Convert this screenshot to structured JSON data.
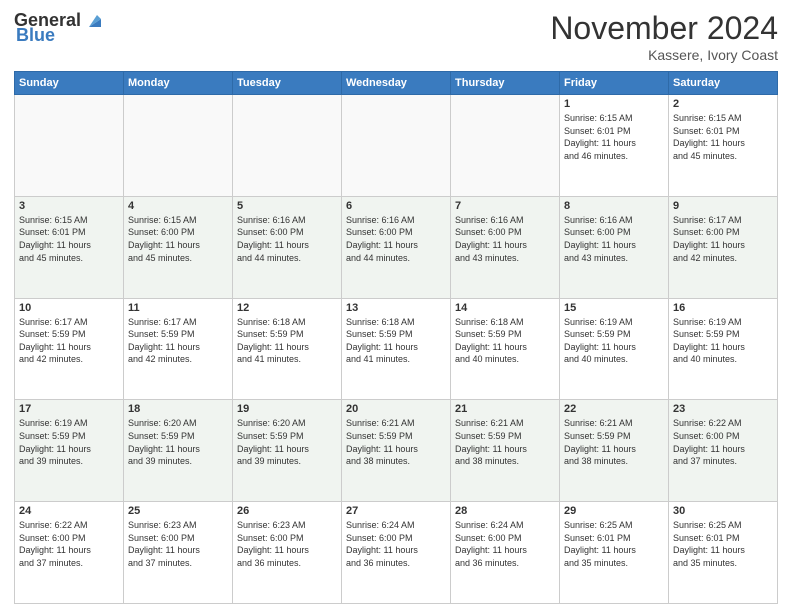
{
  "logo": {
    "general": "General",
    "blue": "Blue"
  },
  "header": {
    "month": "November 2024",
    "location": "Kassere, Ivory Coast"
  },
  "weekdays": [
    "Sunday",
    "Monday",
    "Tuesday",
    "Wednesday",
    "Thursday",
    "Friday",
    "Saturday"
  ],
  "weeks": [
    [
      {
        "day": "",
        "info": ""
      },
      {
        "day": "",
        "info": ""
      },
      {
        "day": "",
        "info": ""
      },
      {
        "day": "",
        "info": ""
      },
      {
        "day": "",
        "info": ""
      },
      {
        "day": "1",
        "info": "Sunrise: 6:15 AM\nSunset: 6:01 PM\nDaylight: 11 hours\nand 46 minutes."
      },
      {
        "day": "2",
        "info": "Sunrise: 6:15 AM\nSunset: 6:01 PM\nDaylight: 11 hours\nand 45 minutes."
      }
    ],
    [
      {
        "day": "3",
        "info": "Sunrise: 6:15 AM\nSunset: 6:01 PM\nDaylight: 11 hours\nand 45 minutes."
      },
      {
        "day": "4",
        "info": "Sunrise: 6:15 AM\nSunset: 6:00 PM\nDaylight: 11 hours\nand 45 minutes."
      },
      {
        "day": "5",
        "info": "Sunrise: 6:16 AM\nSunset: 6:00 PM\nDaylight: 11 hours\nand 44 minutes."
      },
      {
        "day": "6",
        "info": "Sunrise: 6:16 AM\nSunset: 6:00 PM\nDaylight: 11 hours\nand 44 minutes."
      },
      {
        "day": "7",
        "info": "Sunrise: 6:16 AM\nSunset: 6:00 PM\nDaylight: 11 hours\nand 43 minutes."
      },
      {
        "day": "8",
        "info": "Sunrise: 6:16 AM\nSunset: 6:00 PM\nDaylight: 11 hours\nand 43 minutes."
      },
      {
        "day": "9",
        "info": "Sunrise: 6:17 AM\nSunset: 6:00 PM\nDaylight: 11 hours\nand 42 minutes."
      }
    ],
    [
      {
        "day": "10",
        "info": "Sunrise: 6:17 AM\nSunset: 5:59 PM\nDaylight: 11 hours\nand 42 minutes."
      },
      {
        "day": "11",
        "info": "Sunrise: 6:17 AM\nSunset: 5:59 PM\nDaylight: 11 hours\nand 42 minutes."
      },
      {
        "day": "12",
        "info": "Sunrise: 6:18 AM\nSunset: 5:59 PM\nDaylight: 11 hours\nand 41 minutes."
      },
      {
        "day": "13",
        "info": "Sunrise: 6:18 AM\nSunset: 5:59 PM\nDaylight: 11 hours\nand 41 minutes."
      },
      {
        "day": "14",
        "info": "Sunrise: 6:18 AM\nSunset: 5:59 PM\nDaylight: 11 hours\nand 40 minutes."
      },
      {
        "day": "15",
        "info": "Sunrise: 6:19 AM\nSunset: 5:59 PM\nDaylight: 11 hours\nand 40 minutes."
      },
      {
        "day": "16",
        "info": "Sunrise: 6:19 AM\nSunset: 5:59 PM\nDaylight: 11 hours\nand 40 minutes."
      }
    ],
    [
      {
        "day": "17",
        "info": "Sunrise: 6:19 AM\nSunset: 5:59 PM\nDaylight: 11 hours\nand 39 minutes."
      },
      {
        "day": "18",
        "info": "Sunrise: 6:20 AM\nSunset: 5:59 PM\nDaylight: 11 hours\nand 39 minutes."
      },
      {
        "day": "19",
        "info": "Sunrise: 6:20 AM\nSunset: 5:59 PM\nDaylight: 11 hours\nand 39 minutes."
      },
      {
        "day": "20",
        "info": "Sunrise: 6:21 AM\nSunset: 5:59 PM\nDaylight: 11 hours\nand 38 minutes."
      },
      {
        "day": "21",
        "info": "Sunrise: 6:21 AM\nSunset: 5:59 PM\nDaylight: 11 hours\nand 38 minutes."
      },
      {
        "day": "22",
        "info": "Sunrise: 6:21 AM\nSunset: 5:59 PM\nDaylight: 11 hours\nand 38 minutes."
      },
      {
        "day": "23",
        "info": "Sunrise: 6:22 AM\nSunset: 6:00 PM\nDaylight: 11 hours\nand 37 minutes."
      }
    ],
    [
      {
        "day": "24",
        "info": "Sunrise: 6:22 AM\nSunset: 6:00 PM\nDaylight: 11 hours\nand 37 minutes."
      },
      {
        "day": "25",
        "info": "Sunrise: 6:23 AM\nSunset: 6:00 PM\nDaylight: 11 hours\nand 37 minutes."
      },
      {
        "day": "26",
        "info": "Sunrise: 6:23 AM\nSunset: 6:00 PM\nDaylight: 11 hours\nand 36 minutes."
      },
      {
        "day": "27",
        "info": "Sunrise: 6:24 AM\nSunset: 6:00 PM\nDaylight: 11 hours\nand 36 minutes."
      },
      {
        "day": "28",
        "info": "Sunrise: 6:24 AM\nSunset: 6:00 PM\nDaylight: 11 hours\nand 36 minutes."
      },
      {
        "day": "29",
        "info": "Sunrise: 6:25 AM\nSunset: 6:01 PM\nDaylight: 11 hours\nand 35 minutes."
      },
      {
        "day": "30",
        "info": "Sunrise: 6:25 AM\nSunset: 6:01 PM\nDaylight: 11 hours\nand 35 minutes."
      }
    ]
  ]
}
